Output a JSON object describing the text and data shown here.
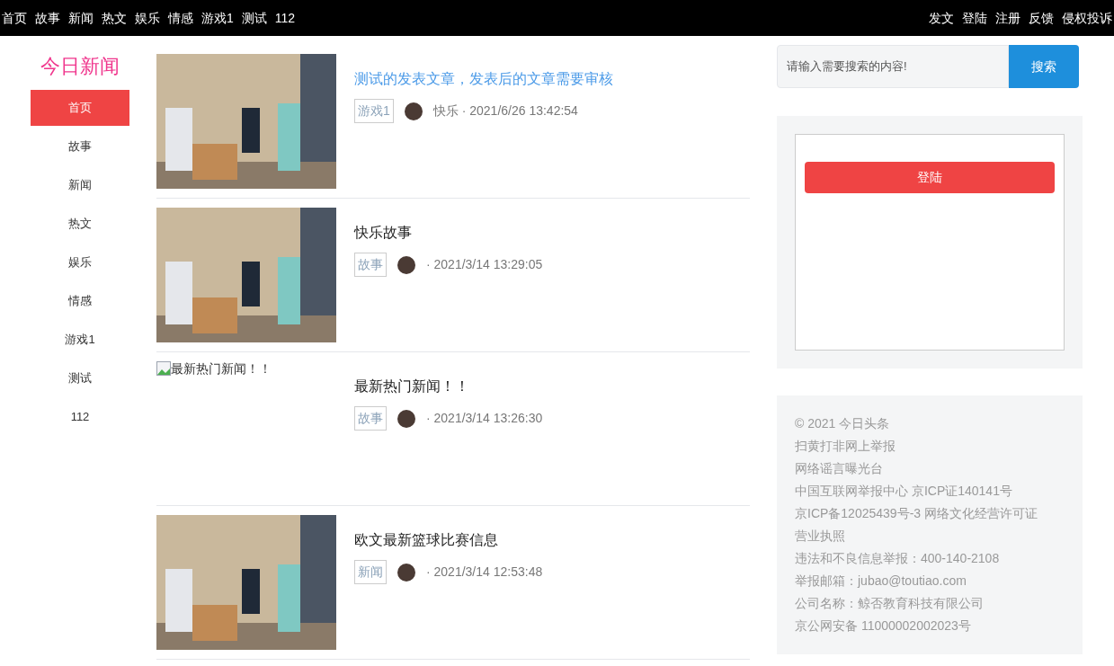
{
  "top_nav": {
    "left": [
      {
        "label": "首页"
      },
      {
        "label": "故事"
      },
      {
        "label": "新闻"
      },
      {
        "label": "热文"
      },
      {
        "label": "娱乐"
      },
      {
        "label": "情感"
      },
      {
        "label": "游戏1"
      },
      {
        "label": "测试"
      },
      {
        "label": "112"
      }
    ],
    "right": [
      {
        "label": "发文"
      },
      {
        "label": "登陆"
      },
      {
        "label": "注册"
      },
      {
        "label": "反馈"
      },
      {
        "label": "侵权投诉"
      }
    ]
  },
  "sidebar": {
    "logo": "今日新闻",
    "items": [
      {
        "label": "首页",
        "selected": true
      },
      {
        "label": "故事",
        "selected": false
      },
      {
        "label": "新闻",
        "selected": false
      },
      {
        "label": "热文",
        "selected": false
      },
      {
        "label": "娱乐",
        "selected": false
      },
      {
        "label": "情感",
        "selected": false
      },
      {
        "label": "游戏1",
        "selected": false
      },
      {
        "label": "测试",
        "selected": false
      },
      {
        "label": "112",
        "selected": false
      }
    ]
  },
  "articles": [
    {
      "image": {
        "kind": "photo"
      },
      "title": "测试的发表文章，发表后的文章需要审核",
      "highlighted": true,
      "tag": "游戏1",
      "meta": "快乐 · 2021/6/26 13:42:54"
    },
    {
      "image": {
        "kind": "photo"
      },
      "title": "快乐故事",
      "highlighted": false,
      "tag": "故事",
      "meta": "· 2021/3/14 13:29:05"
    },
    {
      "image": {
        "kind": "broken",
        "alt": "最新热门新闻！！"
      },
      "title": "最新热门新闻！！",
      "highlighted": false,
      "tag": "故事",
      "meta": "· 2021/3/14 13:26:30"
    },
    {
      "image": {
        "kind": "photo"
      },
      "title": "欧文最新篮球比赛信息",
      "highlighted": false,
      "tag": "新闻",
      "meta": "· 2021/3/14 12:53:48"
    }
  ],
  "search": {
    "placeholder": "请输入需要搜索的内容!",
    "button": "搜索"
  },
  "login_panel": {
    "button": "登陆"
  },
  "footer": {
    "lines": [
      "© 2021 今日头条",
      "扫黄打非网上举报",
      "网络谣言曝光台",
      "中国互联网举报中心 京ICP证140141号",
      "京ICP备12025439号-3 网络文化经营许可证",
      "营业执照",
      "违法和不良信息举报：400-140-2108",
      "举报邮箱：jubao@toutiao.com",
      "公司名称：鲸否教育科技有限公司",
      "京公网安备 11000002002023号"
    ]
  }
}
